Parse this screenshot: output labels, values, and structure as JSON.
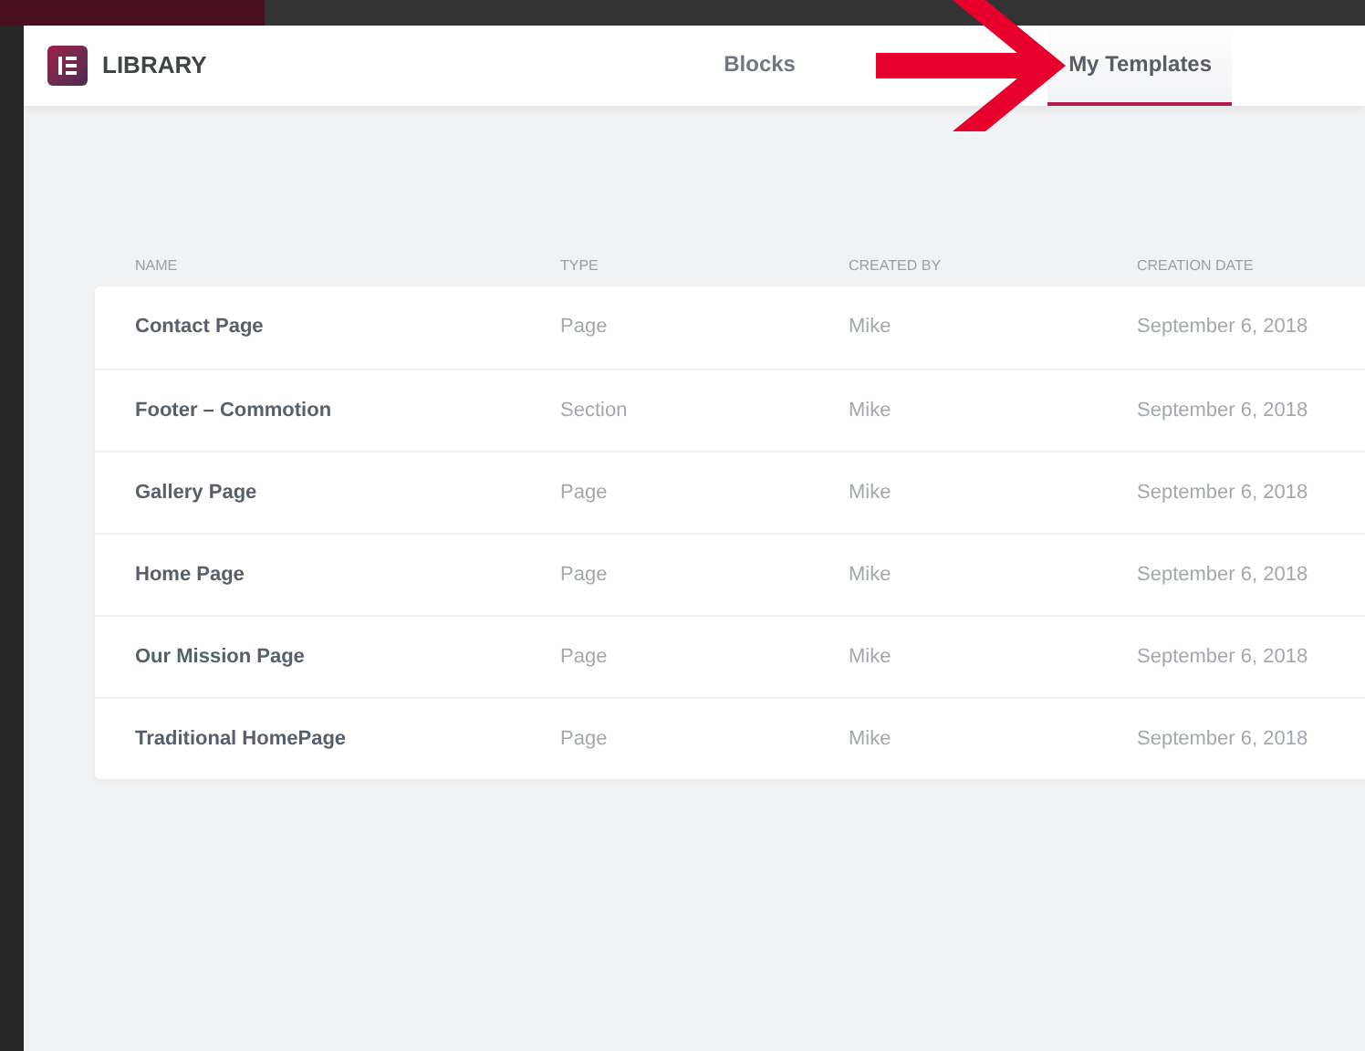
{
  "header": {
    "title": "LIBRARY"
  },
  "tabs": [
    {
      "label": "Blocks",
      "selected": false
    },
    {
      "label": "My Templates",
      "selected": true
    }
  ],
  "table": {
    "columns": [
      "NAME",
      "TYPE",
      "CREATED BY",
      "CREATION DATE"
    ],
    "rows": [
      [
        "Contact Page",
        "Page",
        "Mike",
        "September 6, 2018"
      ],
      [
        "Footer – Commotion",
        "Section",
        "Mike",
        "September 6, 2018"
      ],
      [
        "Gallery Page",
        "Page",
        "Mike",
        "September 6, 2018"
      ],
      [
        "Home Page",
        "Page",
        "Mike",
        "September 6, 2018"
      ],
      [
        "Our Mission Page",
        "Page",
        "Mike",
        "September 6, 2018"
      ],
      [
        "Traditional HomePage",
        "Page",
        "Mike",
        "September 6, 2018"
      ]
    ]
  }
}
